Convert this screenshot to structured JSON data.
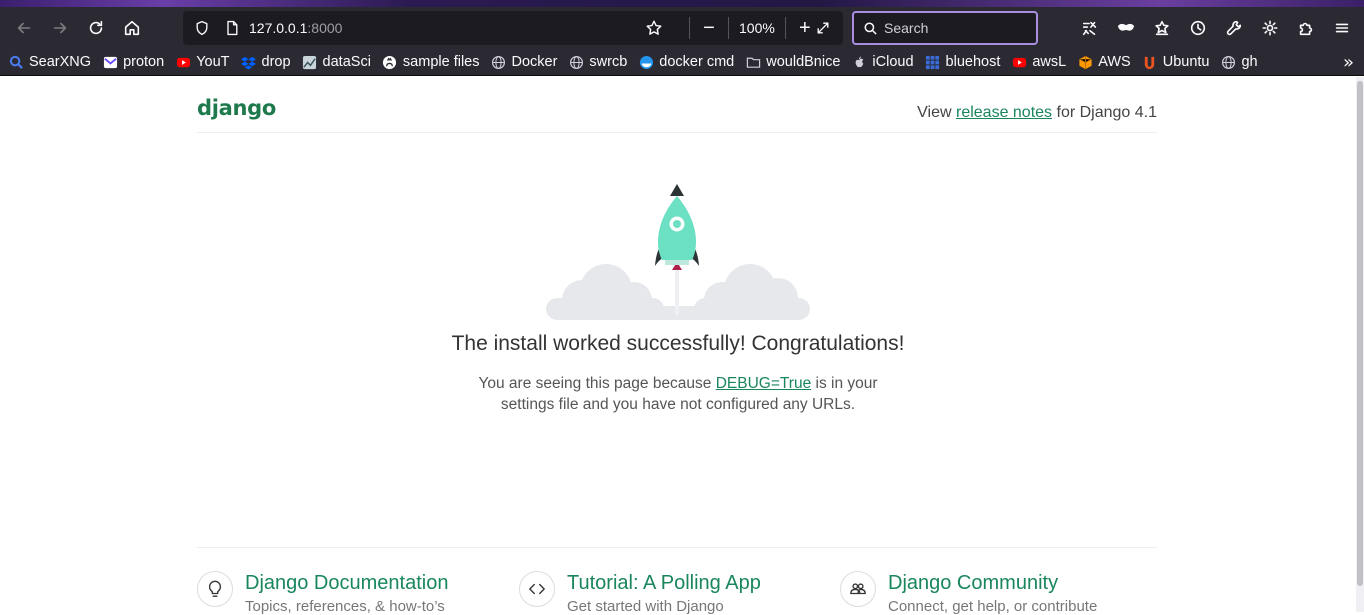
{
  "browser": {
    "url_host": "127.0.0.1",
    "url_port": ":8000",
    "zoom": "100%",
    "search_placeholder": "Search"
  },
  "bookmarks": [
    {
      "label": "SearXNG",
      "icon": "search-icon",
      "color": "#4a7cf0"
    },
    {
      "label": "proton",
      "icon": "proton-icon",
      "color": "#6d4aff"
    },
    {
      "label": "YouT",
      "icon": "youtube-icon",
      "color": "#ff0000"
    },
    {
      "label": "drop",
      "icon": "dropbox-icon",
      "color": "#0061ff"
    },
    {
      "label": "dataSci",
      "icon": "datasci-icon",
      "color": "#8fa3b0"
    },
    {
      "label": "sample files",
      "icon": "github-icon",
      "color": "#ffffff"
    },
    {
      "label": "Docker",
      "icon": "globe-icon",
      "color": "#cfcfd8"
    },
    {
      "label": "swrcb",
      "icon": "globe-icon",
      "color": "#cfcfd8"
    },
    {
      "label": "docker cmd",
      "icon": "docker-icon",
      "color": "#2496ed"
    },
    {
      "label": "wouldBnice",
      "icon": "folder-icon",
      "color": "#cfcfd8"
    },
    {
      "label": "iCloud",
      "icon": "apple-icon",
      "color": "#cfcfd8"
    },
    {
      "label": "bluehost",
      "icon": "bluehost-icon",
      "color": "#3b6bd6"
    },
    {
      "label": "awsL",
      "icon": "youtube-icon",
      "color": "#ff0000"
    },
    {
      "label": "AWS",
      "icon": "aws-icon",
      "color": "#ff9900"
    },
    {
      "label": "Ubuntu",
      "icon": "ubuntu-icon",
      "color": "#e95420"
    },
    {
      "label": "gh",
      "icon": "globe-icon",
      "color": "#cfcfd8"
    }
  ],
  "page": {
    "logo": "django",
    "release_prefix": "View ",
    "release_link": "release notes",
    "release_suffix": " for Django 4.1",
    "headline": "The install worked successfully! Congratulations!",
    "sub_prefix": "You are seeing this page because ",
    "sub_link": "DEBUG=True",
    "sub_mid": " is in your",
    "sub_line2": "settings file and you have not configured any URLs.",
    "cards": [
      {
        "title": "Django Documentation",
        "subtitle": "Topics, references, & how-to’s",
        "icon": "lightbulb-icon"
      },
      {
        "title": "Tutorial: A Polling App",
        "subtitle": "Get started with Django",
        "icon": "code-icon"
      },
      {
        "title": "Django Community",
        "subtitle": "Connect, get help, or contribute",
        "icon": "people-icon"
      }
    ]
  },
  "colors": {
    "django_green": "#19865c",
    "rocket": "#6be0c3",
    "browser_chrome": "#2b2a33",
    "search_focus": "#a98ee0"
  }
}
